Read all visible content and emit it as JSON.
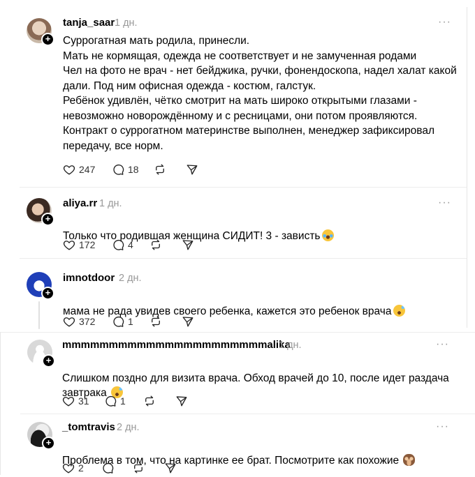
{
  "posts": [
    {
      "username": "tanja_saar",
      "time": "1 дн.",
      "text": "Суррогатная мать родила, принесли.\nМать не кормящая, одежда не соответствует и не замученная родами\nЧел на фото не врач - нет бейджика, ручки, фонендоскопа, надел халат какой\nдали. Под ним офисная одежда - костюм, галстук.\nРебёнок удивлён, чётко смотрит на мать широко открытыми глазами -\nневозможно новорождённому и с ресницами, они потом проявляются.\nКонтракт о суррогатном материнстве выполнен, менеджер зафиксировал\nпередачу, все норм.",
      "likes": "247",
      "comments": "18",
      "emoji": ""
    },
    {
      "username": "aliya.rr",
      "time": "1 дн.",
      "text": "Только что родившая женщина СИДИТ! 3 - зависть",
      "likes": "172",
      "comments": "4",
      "emoji": "laughing-tears-emoji"
    },
    {
      "username": "imnotdoor",
      "time": "2 дн.",
      "text": "мама не рада увидев своего ребенка, кажется это ребенок врача",
      "likes": "372",
      "comments": "1",
      "emoji": "sweat-smile-emoji"
    },
    {
      "username": "mmmmmmmmmmmmmmmmmmmmmmalika",
      "time": "1 дн.",
      "text": "Слишком поздно для визита врача. Обход врачей до 10, после идет раздача\nзавтрака ",
      "likes": "31",
      "comments": "1",
      "emoji": "sweat-smile-emoji"
    },
    {
      "username": "_tomtravis",
      "time": "2 дн.",
      "text": "Проблема в том, что на картинке ее брат. Посмотрите как похожие ",
      "likes": "2",
      "comments": "",
      "emoji": "see-no-evil-monkey-emoji"
    }
  ],
  "more_label": "···",
  "colors": {
    "text": "#000000",
    "muted": "#999999",
    "divider": "#ececec",
    "thread_line": "#e0e0e0"
  }
}
